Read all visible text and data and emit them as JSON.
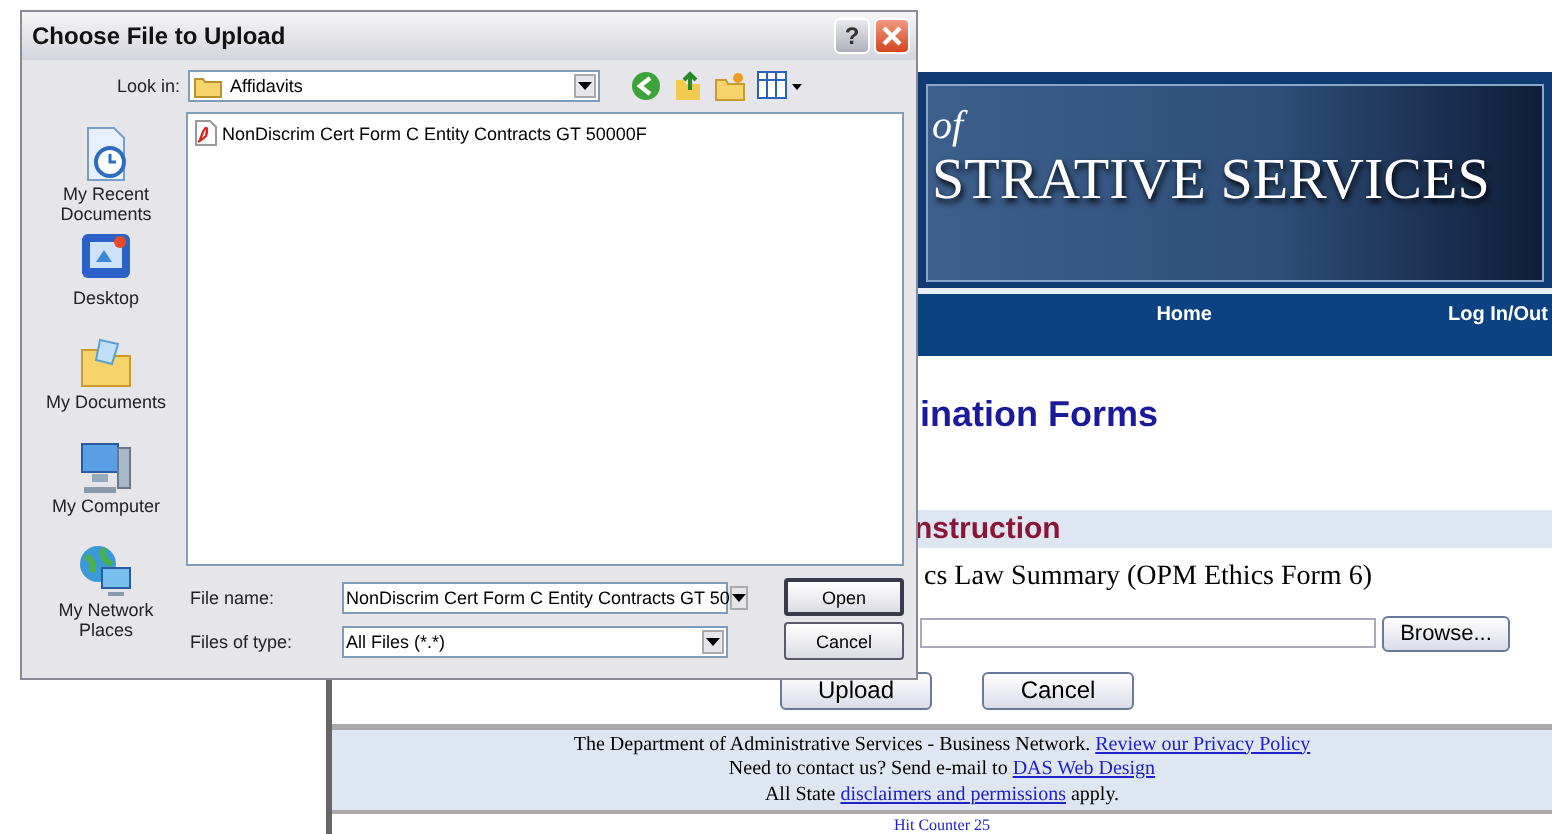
{
  "dialog": {
    "title": "Choose File to Upload",
    "help": "?",
    "look_in": {
      "label": "Look in:",
      "value": "Affidavits"
    },
    "places": [
      {
        "label": "My Recent Documents",
        "kind": "recent"
      },
      {
        "label": "Desktop",
        "kind": "desktop"
      },
      {
        "label": "My Documents",
        "kind": "documents"
      },
      {
        "label": "My Computer",
        "kind": "computer"
      },
      {
        "label": "My Network Places",
        "kind": "network"
      }
    ],
    "files": [
      {
        "name": "NonDiscrim Cert Form C Entity Contracts GT 50000F"
      }
    ],
    "file_name": {
      "label": "File name:",
      "value": "NonDiscrim Cert Form C Entity Contracts GT 50"
    },
    "file_type": {
      "label": "Files of type:",
      "value": "All Files (*.*)"
    },
    "buttons": [
      "Open",
      "Cancel"
    ]
  },
  "page": {
    "banner": {
      "small": "of",
      "title": "STRATIVE SERVICES"
    },
    "nav": [
      "Home",
      "Log In/Out"
    ],
    "heading": "ination Forms",
    "section": "nstruction",
    "form_label": "cs Law Summary (OPM Ethics Form 6)",
    "browse": "Browse...",
    "buttons": [
      "Upload",
      "Cancel"
    ],
    "footer": [
      {
        "text": "The Department of Administrative Services - Business Network. ",
        "link": "Review our Privacy Policy"
      },
      {
        "text": "Need to contact us? Send e-mail to ",
        "link": "DAS Web Design"
      },
      {
        "text": "All State ",
        "link": "disclaimers and permissions",
        "after": " apply."
      }
    ],
    "counter": "Hit Counter 25"
  }
}
